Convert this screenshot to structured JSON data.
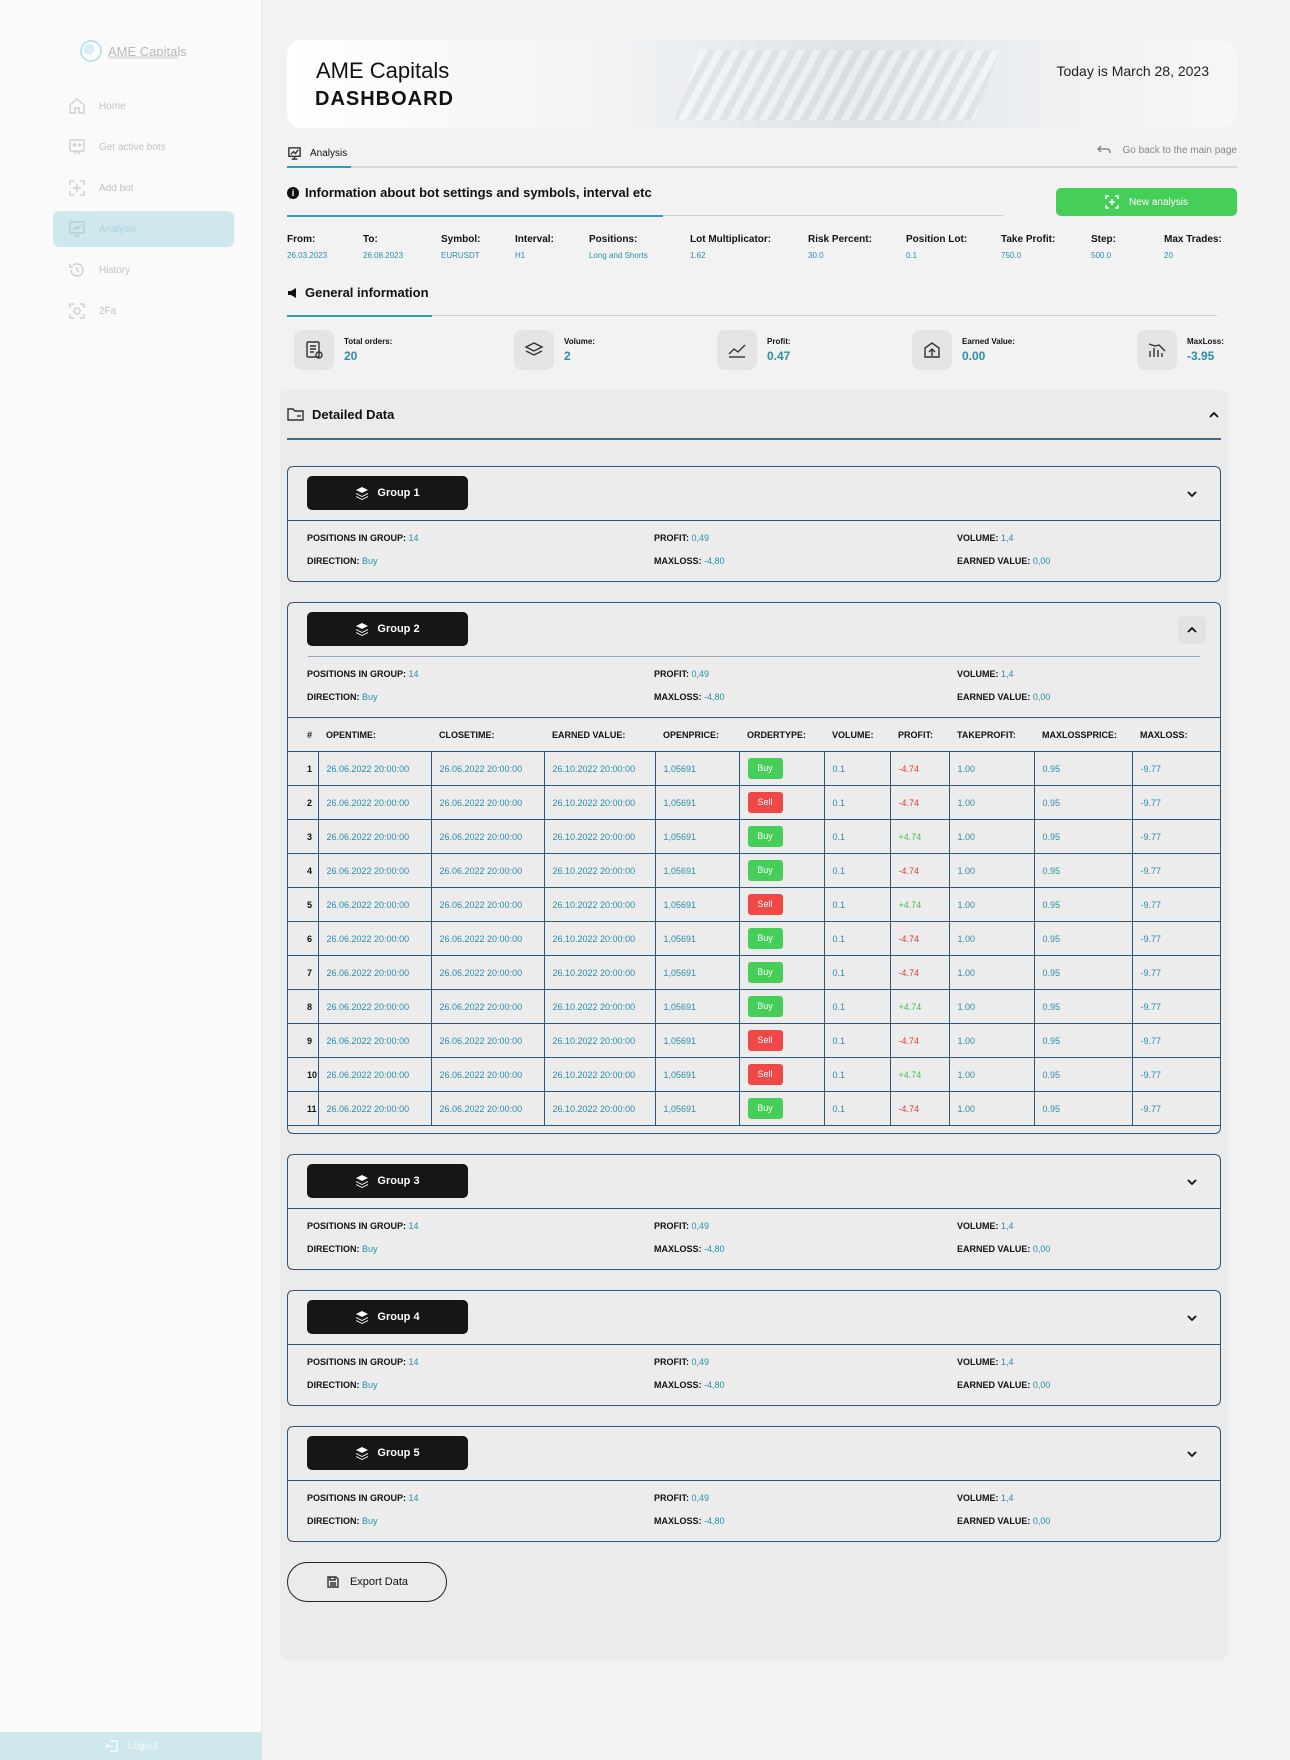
{
  "sidebar": {
    "brand": "AME Capitals",
    "items": [
      {
        "label": "Home",
        "icon": "home-icon"
      },
      {
        "label": "Get active bots",
        "icon": "bot-icon"
      },
      {
        "label": "Add bot",
        "icon": "add-bot-icon"
      },
      {
        "label": "Analysis",
        "icon": "analysis-icon",
        "active": true
      },
      {
        "label": "History",
        "icon": "history-icon"
      },
      {
        "label": "2Fa",
        "icon": "two-factor-icon"
      }
    ],
    "logout": "Logout"
  },
  "header": {
    "title": "AME Capitals",
    "subtitle": "DASHBOARD",
    "date": "Today is March 28, 2023"
  },
  "tabs": {
    "analysis": "Analysis",
    "go_back": "Go back to the main page"
  },
  "info": {
    "title": "Information about bot settings and symbols, interval etc",
    "new_analysis": "New analysis",
    "params": [
      {
        "label": "From:",
        "value": "26.03.2023"
      },
      {
        "label": "To:",
        "value": "26.08.2023"
      },
      {
        "label": "Symbol:",
        "value": "EURUSDT"
      },
      {
        "label": "Interval:",
        "value": "H1"
      },
      {
        "label": "Positions:",
        "value": "Long and Shorts"
      },
      {
        "label": "Lot Multiplicator:",
        "value": "1.62"
      },
      {
        "label": "Risk Percent:",
        "value": "30.0"
      },
      {
        "label": "Position Lot:",
        "value": "0.1"
      },
      {
        "label": "Take Profit:",
        "value": "750.0"
      },
      {
        "label": "Step:",
        "value": "500.0"
      },
      {
        "label": "Max Trades:",
        "value": "20"
      }
    ]
  },
  "general": {
    "title": "General information",
    "stats": [
      {
        "label": "Total orders:",
        "value": "20",
        "icon": "orders-icon"
      },
      {
        "label": "Volume:",
        "value": "2",
        "icon": "layers-icon"
      },
      {
        "label": "Profit:",
        "value": "0.47",
        "icon": "trend-up-icon"
      },
      {
        "label": "Earned Value:",
        "value": "0.00",
        "icon": "earned-icon"
      },
      {
        "label": "MaxLoss:",
        "value": "-3.95",
        "icon": "maxloss-icon"
      }
    ]
  },
  "detailed": {
    "title": "Detailed Data",
    "summary_labels": {
      "positions": "POSITIONS IN GROUP:",
      "direction": "DIRECTION:",
      "profit": "PROFIT:",
      "maxloss": "MAXLOSS:",
      "volume": "VOLUME:",
      "earned": "EARNED VALUE:"
    },
    "groups": [
      {
        "name": "Group 1",
        "positions": "14",
        "direction": "Buy",
        "profit": "0,49",
        "maxloss": "-4,80",
        "volume": "1,4",
        "earned": "0,00"
      },
      {
        "name": "Group 2",
        "positions": "14",
        "direction": "Buy",
        "profit": "0,49",
        "maxloss": "-4,80",
        "volume": "1,4",
        "earned": "0,00"
      },
      {
        "name": "Group 3",
        "positions": "14",
        "direction": "Buy",
        "profit": "0,49",
        "maxloss": "-4,80",
        "volume": "1,4",
        "earned": "0,00"
      },
      {
        "name": "Group 4",
        "positions": "14",
        "direction": "Buy",
        "profit": "0,49",
        "maxloss": "-4,80",
        "volume": "1,4",
        "earned": "0,00"
      },
      {
        "name": "Group 5",
        "positions": "14",
        "direction": "Buy",
        "profit": "0,49",
        "maxloss": "-4,80",
        "volume": "1,4",
        "earned": "0,00"
      }
    ],
    "table": {
      "columns": [
        "#",
        "OPENTIME:",
        "CLOSETIME:",
        "EARNED VALUE:",
        "OPENPRICE:",
        "ORDERTYPE:",
        "VOLUME:",
        "PROFIT:",
        "TAKEPROFIT:",
        "MAXLOSSPRICE:",
        "MAXLOSS:"
      ],
      "rows": [
        {
          "n": "1",
          "open": "26.06.2022 20:00:00",
          "close": "26.06.2022 20:00:00",
          "earned": "26.10.2022 20:00:00",
          "price": "1,05691",
          "type": "Buy",
          "volume": "0.1",
          "profit": "-4.74",
          "tp": "1.00",
          "mlp": "0.95",
          "ml": "-9.77"
        },
        {
          "n": "2",
          "open": "26.06.2022 20:00:00",
          "close": "26.06.2022 20:00:00",
          "earned": "26.10.2022 20:00:00",
          "price": "1,05691",
          "type": "Sell",
          "volume": "0.1",
          "profit": "-4.74",
          "tp": "1.00",
          "mlp": "0.95",
          "ml": "-9.77"
        },
        {
          "n": "3",
          "open": "26.06.2022 20:00:00",
          "close": "26.06.2022 20:00:00",
          "earned": "26.10.2022 20:00:00",
          "price": "1,05691",
          "type": "Buy",
          "volume": "0.1",
          "profit": "+4.74",
          "tp": "1.00",
          "mlp": "0.95",
          "ml": "-9.77"
        },
        {
          "n": "4",
          "open": "26.06.2022 20:00:00",
          "close": "26.06.2022 20:00:00",
          "earned": "26.10.2022 20:00:00",
          "price": "1,05691",
          "type": "Buy",
          "volume": "0.1",
          "profit": "-4.74",
          "tp": "1.00",
          "mlp": "0.95",
          "ml": "-9.77"
        },
        {
          "n": "5",
          "open": "26.06.2022 20:00:00",
          "close": "26.06.2022 20:00:00",
          "earned": "26.10.2022 20:00:00",
          "price": "1,05691",
          "type": "Sell",
          "volume": "0.1",
          "profit": "+4.74",
          "tp": "1.00",
          "mlp": "0.95",
          "ml": "-9.77"
        },
        {
          "n": "6",
          "open": "26.06.2022 20:00:00",
          "close": "26.06.2022 20:00:00",
          "earned": "26.10.2022 20:00:00",
          "price": "1,05691",
          "type": "Buy",
          "volume": "0.1",
          "profit": "-4.74",
          "tp": "1.00",
          "mlp": "0.95",
          "ml": "-9.77"
        },
        {
          "n": "7",
          "open": "26.06.2022 20:00:00",
          "close": "26.06.2022 20:00:00",
          "earned": "26.10.2022 20:00:00",
          "price": "1,05691",
          "type": "Buy",
          "volume": "0.1",
          "profit": "-4.74",
          "tp": "1.00",
          "mlp": "0.95",
          "ml": "-9.77"
        },
        {
          "n": "8",
          "open": "26.06.2022 20:00:00",
          "close": "26.06.2022 20:00:00",
          "earned": "26.10.2022 20:00:00",
          "price": "1,05691",
          "type": "Buy",
          "volume": "0.1",
          "profit": "+4.74",
          "tp": "1.00",
          "mlp": "0.95",
          "ml": "-9.77"
        },
        {
          "n": "9",
          "open": "26.06.2022 20:00:00",
          "close": "26.06.2022 20:00:00",
          "earned": "26.10.2022 20:00:00",
          "price": "1,05691",
          "type": "Sell",
          "volume": "0.1",
          "profit": "-4.74",
          "tp": "1.00",
          "mlp": "0.95",
          "ml": "-9.77"
        },
        {
          "n": "10",
          "open": "26.06.2022 20:00:00",
          "close": "26.06.2022 20:00:00",
          "earned": "26.10.2022 20:00:00",
          "price": "1,05691",
          "type": "Sell",
          "volume": "0.1",
          "profit": "+4.74",
          "tp": "1.00",
          "mlp": "0.95",
          "ml": "-9.77"
        },
        {
          "n": "11",
          "open": "26.06.2022 20:00:00",
          "close": "26.06.2022 20:00:00",
          "earned": "26.10.2022 20:00:00",
          "price": "1,05691",
          "type": "Buy",
          "volume": "0.1",
          "profit": "-4.74",
          "tp": "1.00",
          "mlp": "0.95",
          "ml": "-9.77"
        }
      ]
    },
    "export": "Export Data"
  },
  "colors": {
    "accent": "#2a8ea8",
    "buy": "#45cf58",
    "sell": "#f04747",
    "group_button": "#161616",
    "sidebar_active": "#cfe8ee"
  }
}
